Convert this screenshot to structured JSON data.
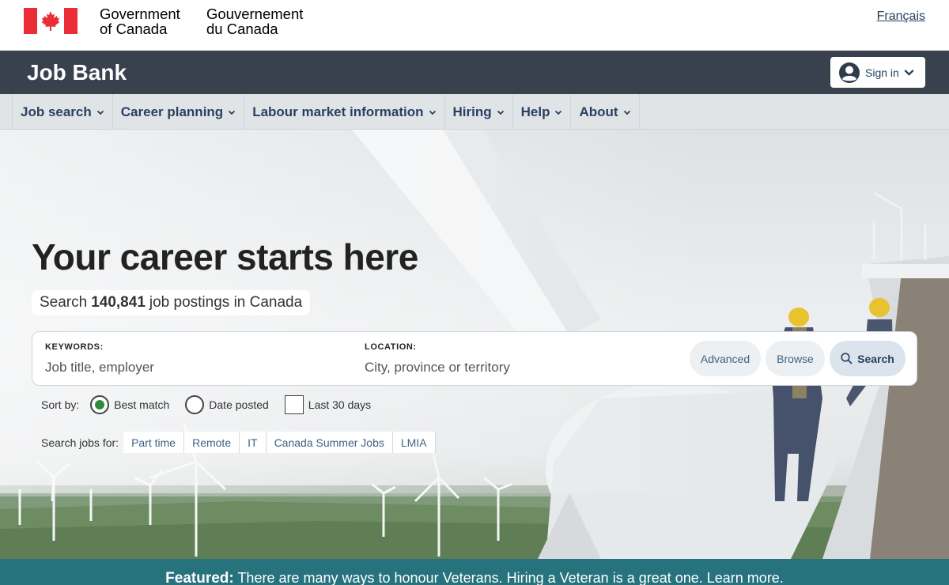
{
  "gov_header": {
    "signature_en_line1": "Government",
    "signature_en_line2": "of Canada",
    "signature_fr_line1": "Gouvernement",
    "signature_fr_line2": "du Canada",
    "language_link": "Français",
    "colors": {
      "flag_red": "#eb2d37"
    }
  },
  "app_bar": {
    "title": "Job Bank",
    "sign_in_label": "Sign in",
    "background": "#38414d"
  },
  "menu": {
    "items": [
      {
        "label": "Job search",
        "icon": "chevron-down-icon"
      },
      {
        "label": "Career planning",
        "icon": "chevron-down-icon"
      },
      {
        "label": "Labour market information",
        "icon": "chevron-down-icon"
      },
      {
        "label": "Hiring",
        "icon": "chevron-down-icon"
      },
      {
        "label": "Help",
        "icon": "chevron-down-icon"
      },
      {
        "label": "About",
        "icon": "chevron-down-icon"
      }
    ]
  },
  "hero": {
    "title": "Your career starts here",
    "count_prefix": "Search",
    "count_value": "140,841",
    "count_suffix": "job postings in Canada",
    "search": {
      "keywords_label": "KEYWORDS:",
      "keywords_placeholder": "Job title, employer",
      "location_label": "LOCATION:",
      "location_placeholder": "City, province or territory",
      "advanced_label": "Advanced",
      "browse_label": "Browse",
      "search_label": "Search",
      "search_icon": "search-icon"
    },
    "sort": {
      "label": "Sort by:",
      "options": [
        "Best match",
        "Date posted"
      ],
      "selected": "Best match",
      "filter_label": "Last 30 days",
      "filter_checked": false
    },
    "quick": {
      "label": "Search jobs for:",
      "chips": [
        "Part time",
        "Remote",
        "IT",
        "Canada Summer Jobs",
        "LMIA"
      ]
    }
  },
  "featured": {
    "label": "Featured:",
    "text": "There are many ways to honour Veterans. Hiring a Veteran is a great one. Learn more.",
    "background": "#26737e"
  }
}
